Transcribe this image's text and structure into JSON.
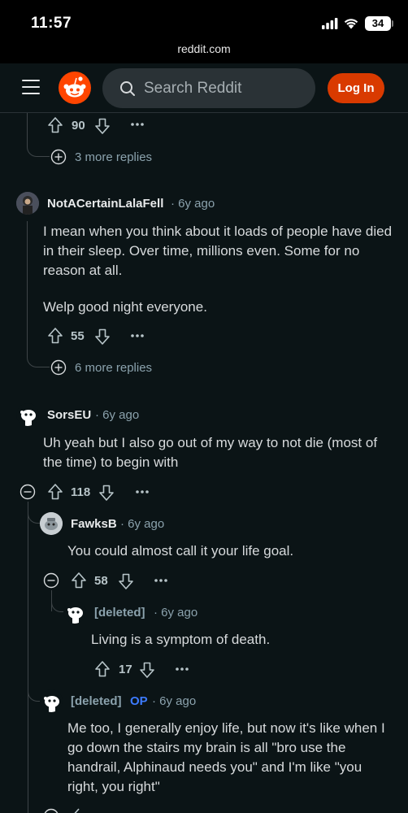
{
  "status_bar": {
    "time": "11:57",
    "battery": "34",
    "url": "reddit.com"
  },
  "header": {
    "search_placeholder": "Search Reddit",
    "login_label": "Log In"
  },
  "colors": {
    "brand": "#ff4500",
    "login_button": "#d93a00",
    "op_badge": "#3d7bff",
    "background": "#0b1416"
  },
  "thread": {
    "top_vote_count": "90",
    "top_more_replies": "3 more replies",
    "comments": [
      {
        "author": "NotACertainLalaFell",
        "time": "6y ago",
        "paragraphs": [
          "I mean when you think about it loads of people have died in their sleep. Over time, millions even. Some for no reason at all.",
          "Welp good night everyone."
        ],
        "votes": "55",
        "more_replies": "6 more replies"
      },
      {
        "author": "SorsEU",
        "time": "6y ago",
        "body": "Uh yeah but I also go out of my way to not die (most of the time) to begin with",
        "votes": "118"
      },
      {
        "author": "FawksB",
        "time": "6y ago",
        "body": "You could almost call it your life goal.",
        "votes": "58"
      },
      {
        "author": "[deleted]",
        "time": "6y ago",
        "body": "Living is a symptom of death.",
        "votes": "17"
      },
      {
        "author": "[deleted]",
        "op_label": "OP",
        "time": "6y ago",
        "body": "Me too, I generally enjoy life, but now it's like when I go down the stairs my brain is all \"bro use the handrail, Alphinaud needs you\" and I'm like \"you right, you right\""
      }
    ]
  },
  "icons": [
    "menu-icon",
    "reddit-logo",
    "search-icon",
    "upvote-icon",
    "downvote-icon",
    "more-options-icon",
    "expand-icon",
    "collapse-icon"
  ]
}
